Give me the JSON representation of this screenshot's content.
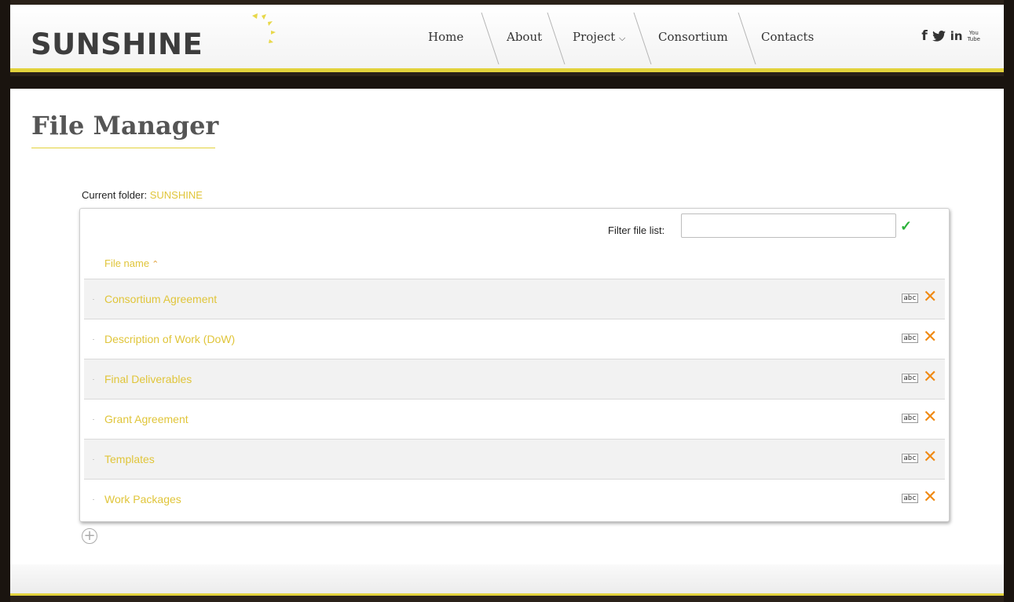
{
  "brand": {
    "logo_text": "SUNSHINE"
  },
  "nav": {
    "items": [
      {
        "label": "Home"
      },
      {
        "label": "About"
      },
      {
        "label": "Project"
      },
      {
        "label": "Consortium"
      },
      {
        "label": "Contacts"
      }
    ]
  },
  "social": {
    "facebook": "f",
    "linkedin": "in",
    "youtube_top": "You",
    "youtube_bottom": "Tube"
  },
  "page": {
    "title": "File Manager"
  },
  "folder": {
    "label": "Current folder:",
    "name": "SUNSHINE"
  },
  "filter": {
    "label": "Filter file list:",
    "value": ""
  },
  "table": {
    "header": "File name",
    "rows": [
      {
        "name": "Consortium Agreement"
      },
      {
        "name": "Description of Work (DoW)"
      },
      {
        "name": "Final Deliverables"
      },
      {
        "name": "Grant Agreement"
      },
      {
        "name": "Templates"
      },
      {
        "name": "Work Packages"
      }
    ],
    "rename_label": "abc"
  },
  "colors": {
    "accent": "#e0c53a",
    "delete": "#f08a12",
    "confirm": "#2bb23a",
    "border": "#e2d23c"
  }
}
